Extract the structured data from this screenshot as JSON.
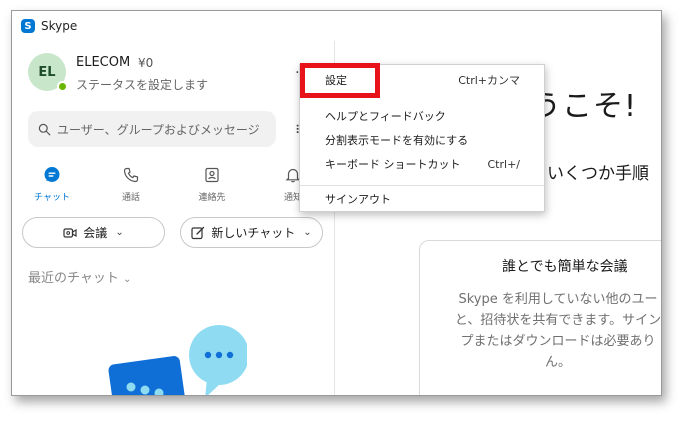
{
  "window": {
    "title": "Skype",
    "app_icon_glyph": "S"
  },
  "profile": {
    "initials": "EL",
    "name": "ELECOM",
    "credit": "¥0",
    "status": "ステータスを設定します"
  },
  "search": {
    "placeholder": "ユーザー、グループおよびメッセージ"
  },
  "nav": {
    "items": [
      {
        "label": "チャット",
        "icon": "chat-icon"
      },
      {
        "label": "通話",
        "icon": "phone-icon"
      },
      {
        "label": "連絡先",
        "icon": "contacts-icon"
      },
      {
        "label": "通知",
        "icon": "bell-icon"
      }
    ]
  },
  "actions": {
    "meeting_label": "会議",
    "new_chat_label": "新しいチャット"
  },
  "recent": {
    "label": "最近のチャット"
  },
  "menu": {
    "items": [
      {
        "label": "設定",
        "shortcut": "Ctrl+カンマ"
      },
      {
        "label": "ヘルプとフィードバック",
        "shortcut": ""
      },
      {
        "label": "分割表示モードを有効にする",
        "shortcut": ""
      },
      {
        "label": "キーボード ショートカット",
        "shortcut": "Ctrl+/"
      },
      {
        "label": "サインアウト",
        "shortcut": ""
      }
    ]
  },
  "main": {
    "welcome": "うこそ!",
    "subtitle": "いくつか手順",
    "card": {
      "title": "誰とでも簡単な会議",
      "body_lines": [
        "Skype を利用していない他のユー",
        "と、招待状を共有できます。サイン",
        "プまたはダウンロードは必要あり",
        "ん。"
      ]
    }
  },
  "colors": {
    "accent": "#0078d4",
    "presence": "#6bb700",
    "highlight_box": "#e8121b",
    "illustration_light": "#8fdcf2",
    "illustration_dark": "#0f6fd6"
  }
}
